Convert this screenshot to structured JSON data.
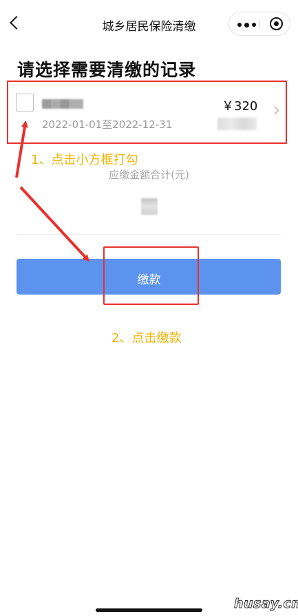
{
  "nav": {
    "title": "城乡居民保险清缴",
    "back_icon": "chevron-left-icon",
    "more_icon": "more-dots-icon",
    "close_icon": "target-circle-icon"
  },
  "page": {
    "heading": "请选择需要清缴的记录"
  },
  "record": {
    "amount": "￥320",
    "period": "2022-01-01至2022-12-31",
    "checked": false
  },
  "summary": {
    "total_label": "应缴金额合计(元)"
  },
  "actions": {
    "pay_label": "缴款"
  },
  "annotations": {
    "step1": "1、点击小方框打勾",
    "step2": "2、点击缴款",
    "highlight_color": "#e8312c",
    "text_color": "#f0b400"
  },
  "theme": {
    "primary": "#5b93ee"
  },
  "watermark": "husay.cn"
}
